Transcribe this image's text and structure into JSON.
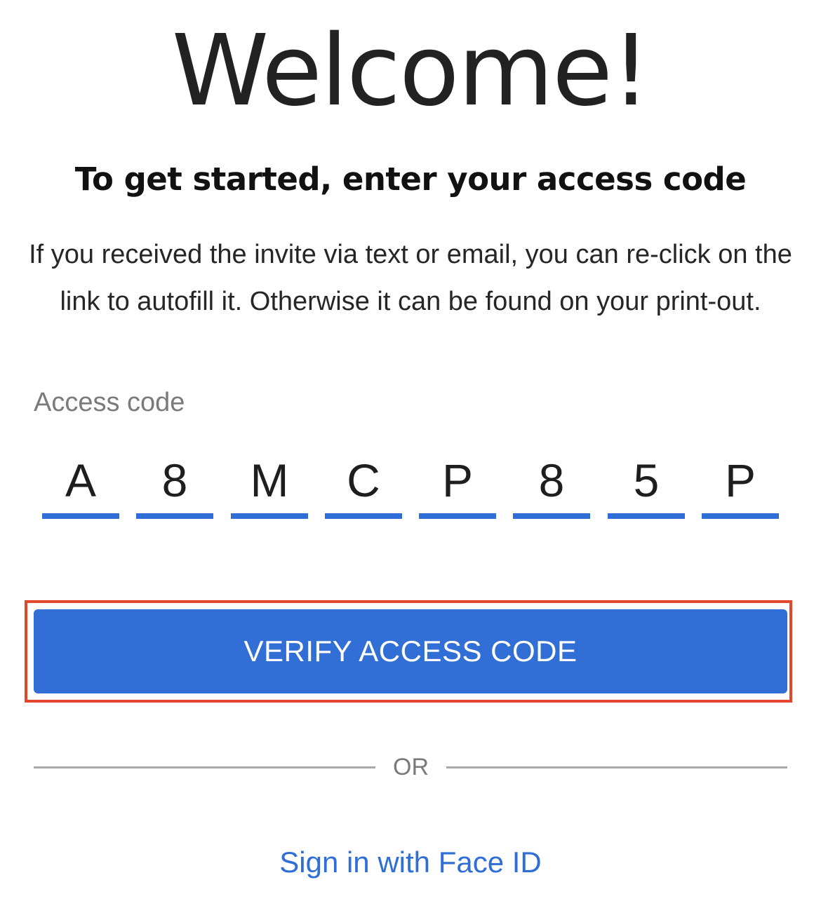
{
  "header": {
    "title": "Welcome!",
    "subtitle": "To get started, enter your access code",
    "description": "If you received the invite via text or email, you can re-click on the link to autofill it. Otherwise it can be found on your print-out."
  },
  "access_code": {
    "label": "Access code",
    "characters": [
      "A",
      "8",
      "M",
      "C",
      "P",
      "8",
      "5",
      "P"
    ]
  },
  "actions": {
    "verify_label": "VERIFY ACCESS CODE",
    "divider_label": "OR",
    "face_id_label": "Sign in with Face ID"
  },
  "colors": {
    "accent": "#316fd6",
    "highlight_frame": "#e2462b",
    "divider": "#a8a8a8"
  }
}
